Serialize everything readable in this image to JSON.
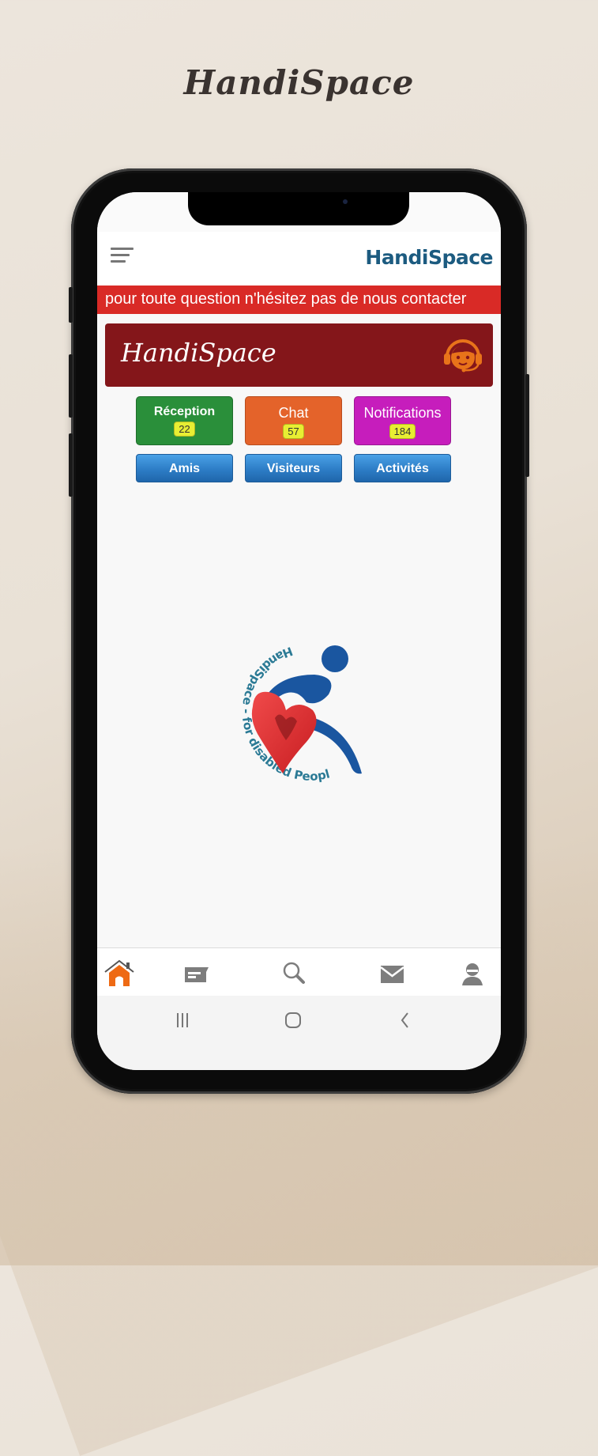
{
  "promo": {
    "title": "HandiSpace"
  },
  "app": {
    "header_title": "HandiSpace",
    "marquee_text": "pour toute question n'hésitez pas de nous contacter",
    "banner_title": "HandiSpace",
    "banner_icon": "support-headset-icon"
  },
  "tiles": [
    {
      "label": "Réception",
      "count": "22",
      "color": "#2a8f3a"
    },
    {
      "label": "Chat",
      "count": "57",
      "color": "#e4632a"
    },
    {
      "label": "Notifications",
      "count": "184",
      "color": "#c61dbc"
    }
  ],
  "buttons": [
    {
      "label": "Amis"
    },
    {
      "label": "Visiteurs"
    },
    {
      "label": "Activités"
    }
  ],
  "logo": {
    "tagline": "HandiSpace - for disabled People"
  },
  "bottom_nav": [
    {
      "name": "home",
      "icon": "home-icon",
      "active": true
    },
    {
      "name": "messages",
      "icon": "message-icon",
      "active": false
    },
    {
      "name": "search",
      "icon": "search-icon",
      "active": false
    },
    {
      "name": "mail",
      "icon": "mail-icon",
      "active": false
    },
    {
      "name": "profile",
      "icon": "profile-icon",
      "active": false
    }
  ],
  "colors": {
    "accent_active": "#ee6a14",
    "marquee_bg": "#d92a26",
    "banner_bg": "#84161a",
    "brand_blue": "#1c5b80",
    "badge_bg": "#e8ee33"
  }
}
